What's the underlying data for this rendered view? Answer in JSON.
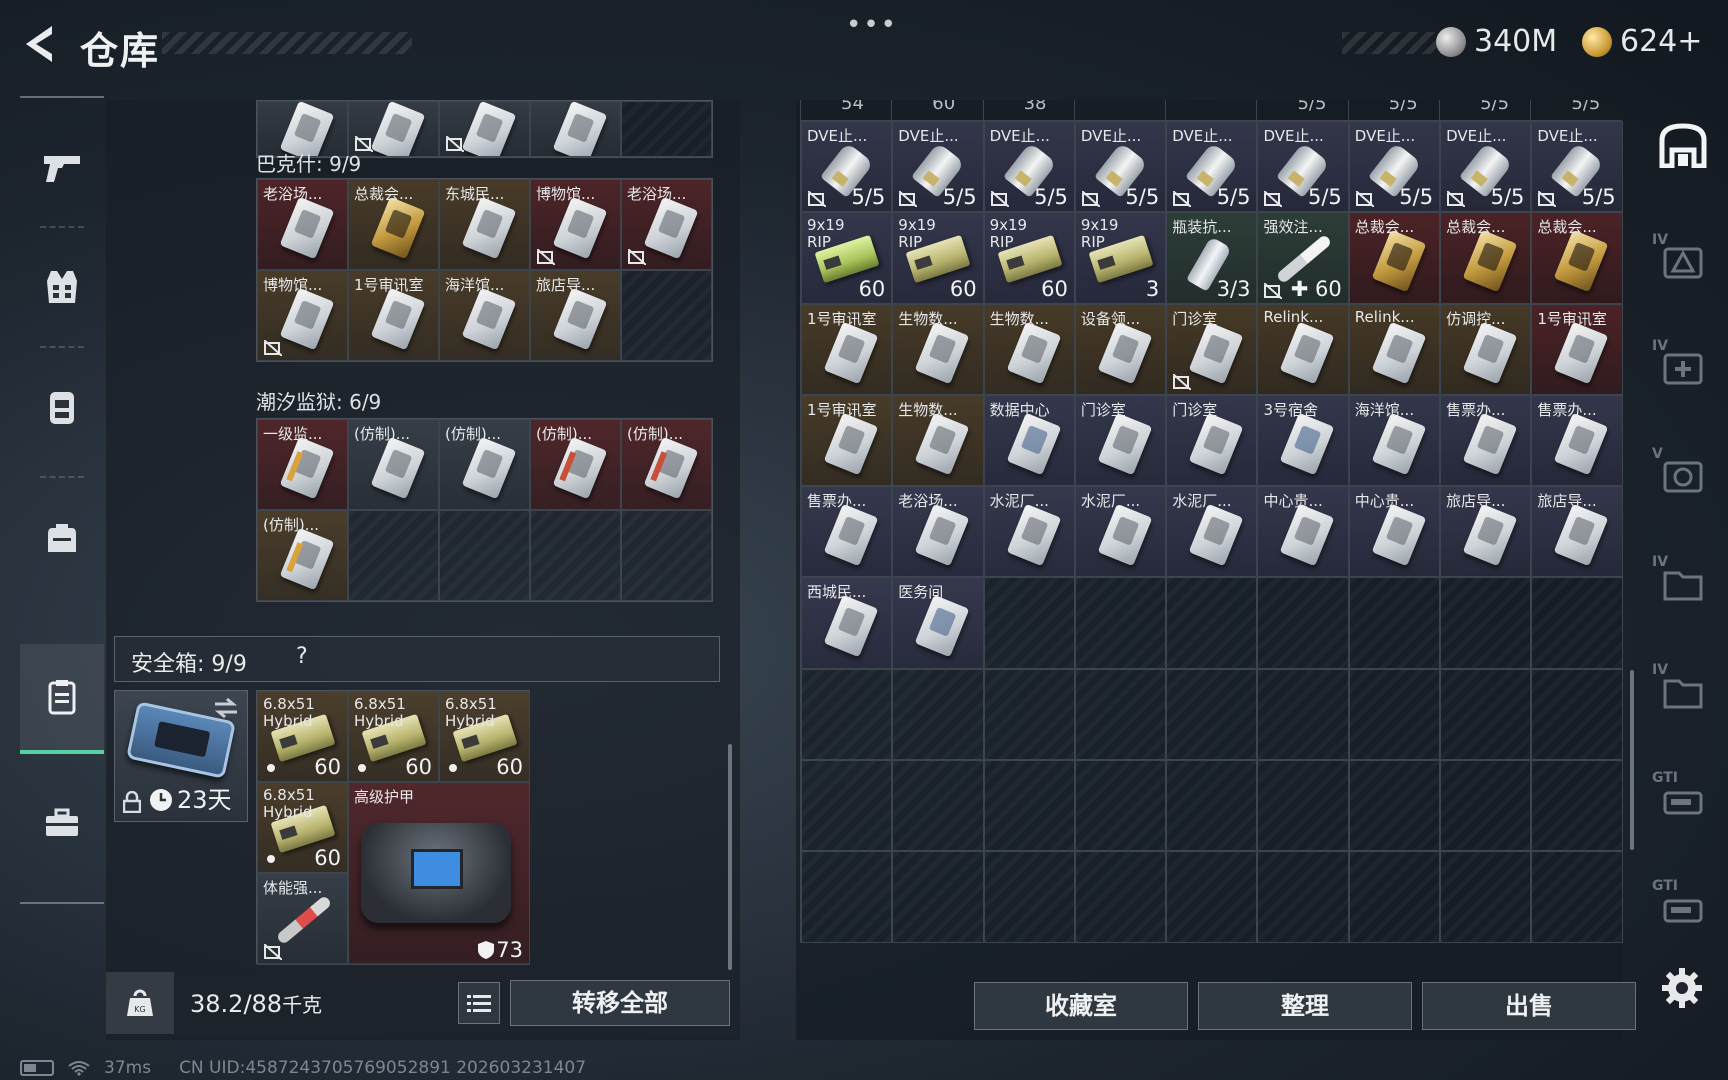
{
  "header": {
    "title": "仓库",
    "more": "•••",
    "currencies": [
      {
        "id": "silver",
        "value": "340M"
      },
      {
        "id": "gold",
        "value": "624+"
      }
    ]
  },
  "left_nav": {
    "items": [
      {
        "id": "weapons",
        "icon": "pistol-icon"
      },
      {
        "id": "armor",
        "icon": "vest-icon"
      },
      {
        "id": "chest-rig",
        "icon": "chest-rig-icon"
      },
      {
        "id": "backpack",
        "icon": "backpack-icon"
      },
      {
        "id": "keycard-case",
        "icon": "keycard-case-icon",
        "active": true
      },
      {
        "id": "safe-case",
        "icon": "briefcase-icon"
      }
    ]
  },
  "left_panel": {
    "section_bakeshi": {
      "title": "巴克什: 9/9"
    },
    "section_chaoxi": {
      "title": "潮汐监狱: 6/9"
    },
    "bakeshi_cells": [
      {
        "label": "老浴场...",
        "rarity": "red",
        "card": "white",
        "locked": false
      },
      {
        "label": "总裁会...",
        "rarity": "gold",
        "card": "gold",
        "locked": false
      },
      {
        "label": "东城民...",
        "rarity": "gold",
        "card": "white",
        "locked": false
      },
      {
        "label": "博物馆...",
        "rarity": "red",
        "card": "white",
        "locked": true
      },
      {
        "label": "老浴场...",
        "rarity": "red",
        "card": "white",
        "locked": true
      },
      {
        "label": "博物馆...",
        "rarity": "gold",
        "card": "white",
        "locked": true
      },
      {
        "label": "1号审讯室",
        "rarity": "gold",
        "card": "white",
        "locked": false
      },
      {
        "label": "海洋馆...",
        "rarity": "gold",
        "card": "white",
        "locked": false
      },
      {
        "label": "旅店导...",
        "rarity": "gold",
        "card": "white",
        "locked": false
      }
    ],
    "chaoxi_cells": [
      {
        "label": "一级监...",
        "rarity": "red",
        "card": "stripe"
      },
      {
        "label": "(仿制)...",
        "rarity": "gray",
        "card": "white"
      },
      {
        "label": "(仿制)...",
        "rarity": "gray",
        "card": "white"
      },
      {
        "label": "(仿制)...",
        "rarity": "red",
        "card": "stripe-red"
      },
      {
        "label": "(仿制)...",
        "rarity": "red",
        "card": "stripe-red"
      },
      {
        "label": "(仿制)...",
        "rarity": "gold",
        "card": "stripe"
      }
    ]
  },
  "safebox": {
    "title": "安全箱: 9/9",
    "help": "?",
    "duration": "23天",
    "items": [
      {
        "label": "6.8x51",
        "label2": "Hybrid",
        "count": "60"
      },
      {
        "label": "6.8x51",
        "label2": "Hybrid",
        "count": "60"
      },
      {
        "label": "6.8x51",
        "label2": "Hybrid",
        "count": "60"
      },
      {
        "label": "6.8x51",
        "label2": "Hybrid",
        "count": "60"
      },
      {
        "label": "体能强...",
        "count": ""
      }
    ],
    "armor": {
      "label": "高级护甲",
      "durability": "73"
    }
  },
  "footer_left": {
    "weight": "38.2/88",
    "weight_unit": "千克",
    "transfer_all": "转移全部"
  },
  "stash": {
    "top_counts": [
      "54",
      "60",
      "38",
      "",
      "",
      "5/5",
      "5/5",
      "5/5",
      "5/5"
    ],
    "items": [
      {
        "label": "DVE止...",
        "count": "5/5",
        "kind": "vial",
        "rarity": "purple",
        "locked": true
      },
      {
        "label": "DVE止...",
        "count": "5/5",
        "kind": "vial",
        "rarity": "purple",
        "locked": true
      },
      {
        "label": "DVE止...",
        "count": "5/5",
        "kind": "vial",
        "rarity": "purple",
        "locked": true
      },
      {
        "label": "DVE止...",
        "count": "5/5",
        "kind": "vial",
        "rarity": "purple",
        "locked": true
      },
      {
        "label": "DVE止...",
        "count": "5/5",
        "kind": "vial",
        "rarity": "purple",
        "locked": true
      },
      {
        "label": "DVE止...",
        "count": "5/5",
        "kind": "vial",
        "rarity": "purple",
        "locked": true
      },
      {
        "label": "DVE止...",
        "count": "5/5",
        "kind": "vial",
        "rarity": "purple",
        "locked": true
      },
      {
        "label": "DVE止...",
        "count": "5/5",
        "kind": "vial",
        "rarity": "purple",
        "locked": true
      },
      {
        "label": "DVE止...",
        "count": "5/5",
        "kind": "vial",
        "rarity": "purple",
        "locked": true
      },
      {
        "label": "9x19",
        "label2": "RIP",
        "count": "60",
        "kind": "ammo-lime",
        "rarity": "purple"
      },
      {
        "label": "9x19",
        "label2": "RIP",
        "count": "60",
        "kind": "ammo",
        "rarity": "purple"
      },
      {
        "label": "9x19",
        "label2": "RIP",
        "count": "60",
        "kind": "ammo",
        "rarity": "purple"
      },
      {
        "label": "9x19",
        "label2": "RIP",
        "count": "3",
        "kind": "ammo",
        "rarity": "purple"
      },
      {
        "label": "瓶装抗...",
        "count": "3/3",
        "kind": "bottle",
        "rarity": "green"
      },
      {
        "label": "强效注...",
        "count": "✚ 60",
        "kind": "injector",
        "rarity": "green",
        "locked": true
      },
      {
        "label": "总裁会...",
        "kind": "card-gold",
        "rarity": "red"
      },
      {
        "label": "总裁会...",
        "kind": "card-gold",
        "rarity": "red"
      },
      {
        "label": "总裁会...",
        "kind": "card-gold",
        "rarity": "red"
      },
      {
        "label": "1号审讯室",
        "kind": "card",
        "rarity": "gold"
      },
      {
        "label": "生物数...",
        "kind": "card",
        "rarity": "gold"
      },
      {
        "label": "生物数...",
        "kind": "card",
        "rarity": "gold"
      },
      {
        "label": "设备领...",
        "kind": "card",
        "rarity": "gold"
      },
      {
        "label": "门诊室",
        "kind": "card",
        "rarity": "gold",
        "locked": true
      },
      {
        "label": "Relink...",
        "kind": "card",
        "rarity": "gold"
      },
      {
        "label": "Relink...",
        "kind": "card",
        "rarity": "gold"
      },
      {
        "label": "仿调控...",
        "kind": "card",
        "rarity": "gold"
      },
      {
        "label": "1号审讯室",
        "kind": "card",
        "rarity": "red"
      },
      {
        "label": "1号审讯室",
        "kind": "card",
        "rarity": "gold"
      },
      {
        "label": "生物数...",
        "kind": "card",
        "rarity": "gold"
      },
      {
        "label": "数据中心",
        "kind": "card-blue",
        "rarity": "purple"
      },
      {
        "label": "门诊室",
        "kind": "card",
        "rarity": "purple"
      },
      {
        "label": "门诊室",
        "kind": "card",
        "rarity": "purple"
      },
      {
        "label": "3号宿舍",
        "kind": "card-blue",
        "rarity": "purple"
      },
      {
        "label": "海洋馆...",
        "kind": "card",
        "rarity": "purple"
      },
      {
        "label": "售票办...",
        "kind": "card",
        "rarity": "purple"
      },
      {
        "label": "售票办...",
        "kind": "card",
        "rarity": "purple"
      },
      {
        "label": "售票办...",
        "kind": "card",
        "rarity": "purple"
      },
      {
        "label": "老浴场...",
        "kind": "card",
        "rarity": "purple"
      },
      {
        "label": "水泥厂...",
        "kind": "card",
        "rarity": "purple"
      },
      {
        "label": "水泥厂...",
        "kind": "card",
        "rarity": "purple"
      },
      {
        "label": "水泥厂...",
        "kind": "card",
        "rarity": "purple"
      },
      {
        "label": "中心贵...",
        "kind": "card",
        "rarity": "purple"
      },
      {
        "label": "中心贵...",
        "kind": "card",
        "rarity": "purple"
      },
      {
        "label": "旅店导...",
        "kind": "card",
        "rarity": "purple"
      },
      {
        "label": "旅店导...",
        "kind": "card",
        "rarity": "purple"
      },
      {
        "label": "西城民...",
        "kind": "card",
        "rarity": "purple"
      },
      {
        "label": "医务间",
        "kind": "card-blue",
        "rarity": "purple"
      }
    ],
    "total_cells": 81
  },
  "actions": {
    "collection": "收藏室",
    "sort": "整理",
    "sell": "出售"
  },
  "right_rail": {
    "items": [
      {
        "id": "stash-home",
        "tag": "",
        "icon": "stash-home-icon"
      },
      {
        "id": "tier4-a",
        "tag": "IV",
        "icon": "warning-card-icon"
      },
      {
        "id": "tier4-b",
        "tag": "IV",
        "icon": "medkit-icon"
      },
      {
        "id": "tier5",
        "tag": "V",
        "icon": "scope-icon"
      },
      {
        "id": "tier4-c",
        "tag": "IV",
        "icon": "folder-icon"
      },
      {
        "id": "tier4-d",
        "tag": "IV",
        "icon": "folder-icon"
      },
      {
        "id": "gti-a",
        "tag": "GTI",
        "icon": "weapon-case-icon"
      },
      {
        "id": "gti-b",
        "tag": "GTI",
        "icon": "weapon-case-icon"
      }
    ]
  },
  "status": {
    "ping": "37ms",
    "uid": "CN UID:4587243705769052891 202603231407"
  }
}
